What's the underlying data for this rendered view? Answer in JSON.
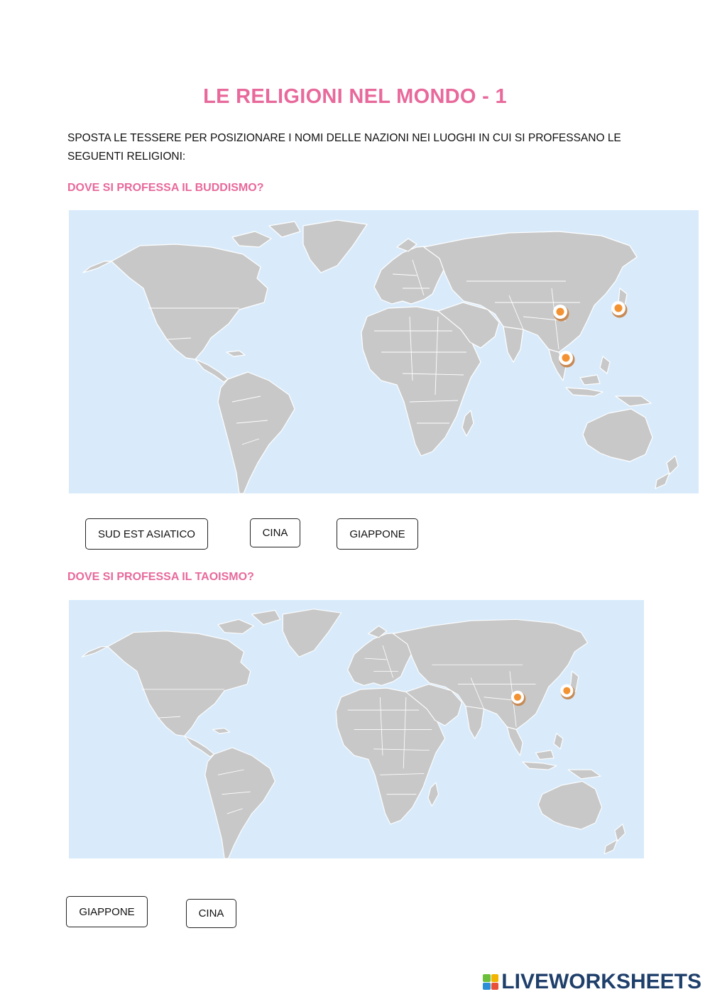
{
  "title": "LE RELIGIONI NEL MONDO - 1",
  "instructions": "SPOSTA LE TESSERE PER POSIZIONARE I NOMI DELLE NAZIONI NEI LUOGHI IN CUI SI PROFESSANO LE SEGUENTI RELIGIONI:",
  "sections": [
    {
      "question": "DOVE SI PROFESSA IL BUDDISMO?",
      "tiles": [
        "SUD EST ASIATICO",
        "CINA",
        "GIAPPONE"
      ]
    },
    {
      "question": "DOVE SI PROFESSA IL TAOISMO?",
      "tiles": [
        "GIAPPONE",
        "CINA"
      ]
    }
  ],
  "branding": {
    "logo_text": "LIVEWORKSHEETS",
    "logo_colors": [
      "#6bbf3a",
      "#f2b400",
      "#2a8fd6",
      "#e8503a"
    ]
  },
  "colors": {
    "accent": "#e8699b",
    "sea": "#d9ebfb",
    "land": "#c8c8c8",
    "pin": "#f39232"
  },
  "icons": [
    "map-pin-icon"
  ]
}
